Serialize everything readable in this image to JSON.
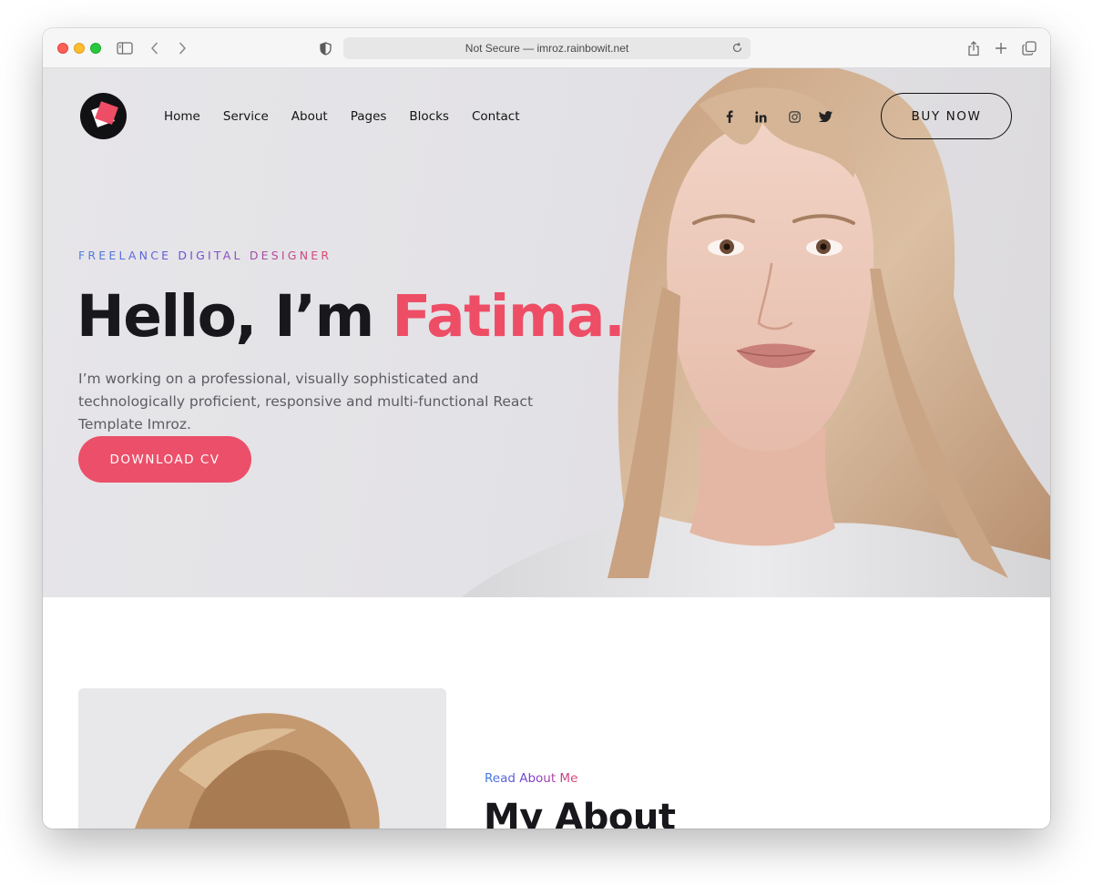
{
  "browser": {
    "address_text": "Not Secure — imroz.rainbowit.net",
    "icons": [
      "sidebar-icon",
      "back-icon",
      "forward-icon",
      "shield-icon",
      "reload-icon",
      "share-icon",
      "new-tab-icon",
      "tabs-overview-icon"
    ]
  },
  "header": {
    "nav": [
      "Home",
      "Service",
      "About",
      "Pages",
      "Blocks",
      "Contact"
    ],
    "social_icons": [
      "facebook-icon",
      "linkedin-icon",
      "instagram-icon",
      "twitter-icon"
    ],
    "buy_label": "BUY NOW"
  },
  "hero": {
    "eyebrow": "FREELANCE DIGITAL DESIGNER",
    "headline_prefix": "Hello, I’m ",
    "headline_name": "Fatima.",
    "intro": "I’m working on a professional, visually sophisticated and technologically proficient, responsive and multi-functional React Template Imroz.",
    "cta_label": "DOWNLOAD CV"
  },
  "about": {
    "eyebrow": "Read About Me",
    "title": "My About"
  },
  "colors": {
    "accent": "#ec4f69",
    "text_dark": "#17171c",
    "hero_bg": "#e4e3e6"
  }
}
